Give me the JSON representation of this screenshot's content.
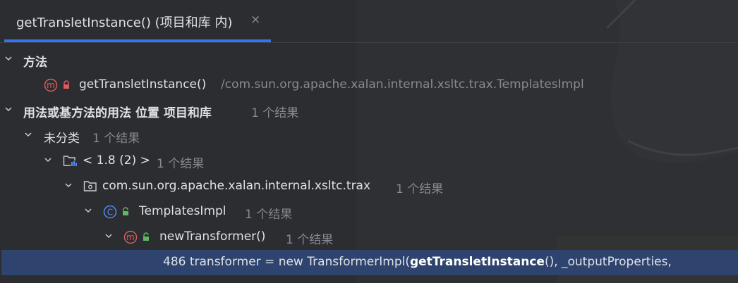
{
  "tab": {
    "title": "getTransletInstance() (项目和库 内)",
    "close": "×"
  },
  "tree": {
    "methods_header": "方法",
    "method_entry": {
      "name": "getTransletInstance()",
      "path": "/com.sun.org.apache.xalan.internal.xsltc.trax.TemplatesImpl"
    },
    "usages_header": {
      "label": "用法或基方法的用法 位置 项目和库",
      "count": "1 个结果"
    },
    "uncategorized": {
      "label": "未分类",
      "count": "1 个结果"
    },
    "jdk": {
      "label": "< 1.8 (2) >",
      "count": "1 个结果"
    },
    "package": {
      "label": "com.sun.org.apache.xalan.internal.xsltc.trax",
      "count": "1 个结果"
    },
    "class": {
      "label": "TemplatesImpl",
      "count": "1 个结果"
    },
    "method": {
      "label": "newTransformer()",
      "count": "1 个结果"
    },
    "usage_line": {
      "line_no": "486",
      "before": " transformer = new TransformerImpl(",
      "match": "getTransletInstance",
      "after": "(), _outputProperties,"
    }
  },
  "colors": {
    "background": "#2b2d30",
    "selection": "#2e436e",
    "tab_underline": "#3574f0",
    "method_icon": "#db5c5c",
    "class_icon": "#548af7",
    "lock_green": "#5fb865",
    "lock_red": "#db5c5c"
  },
  "icons": [
    "chevron-down-icon",
    "method-icon",
    "lock-icon",
    "class-icon",
    "library-icon",
    "package-icon",
    "close-icon"
  ]
}
